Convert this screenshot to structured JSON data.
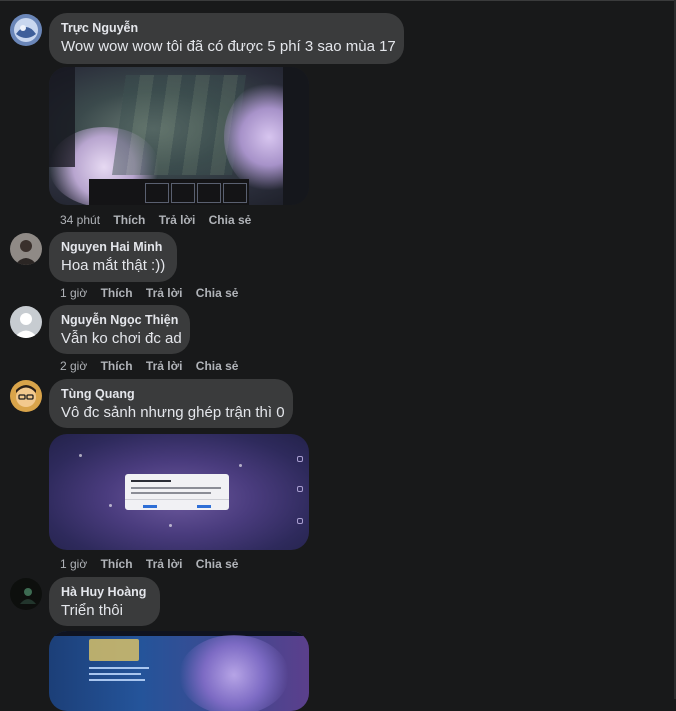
{
  "comments": [
    {
      "author": "Trực Nguyễn",
      "text": "Wow wow wow tôi đã có được 5 phí 3 sao mùa 17",
      "has_image": true,
      "time": "34 phút",
      "like": "Thích",
      "reply": "Trả lời",
      "share": "Chia sẻ"
    },
    {
      "author": "Nguyen Hai Minh",
      "text": "Hoa mắt thật :))",
      "has_image": false,
      "time": "1 giờ",
      "like": "Thích",
      "reply": "Trả lời",
      "share": "Chia sẻ"
    },
    {
      "author": "Nguyễn Ngọc Thiện",
      "text": "Vẫn ko chơi đc ad",
      "has_image": false,
      "time": "2 giờ",
      "like": "Thích",
      "reply": "Trả lời",
      "share": "Chia sẻ"
    },
    {
      "author": "Tùng Quang",
      "text": "Vô đc sảnh nhưng ghép trận thì 0",
      "has_image": true,
      "time": "1 giờ",
      "like": "Thích",
      "reply": "Trả lời",
      "share": "Chia sẻ"
    },
    {
      "author": "Hà Huy Hoàng",
      "text": "Triển thôi",
      "has_image": true
    }
  ],
  "colors": {
    "background": "#18191a",
    "bubble": "#3a3b3c",
    "text": "#e4e6eb",
    "secondary": "#b0b3b8"
  }
}
